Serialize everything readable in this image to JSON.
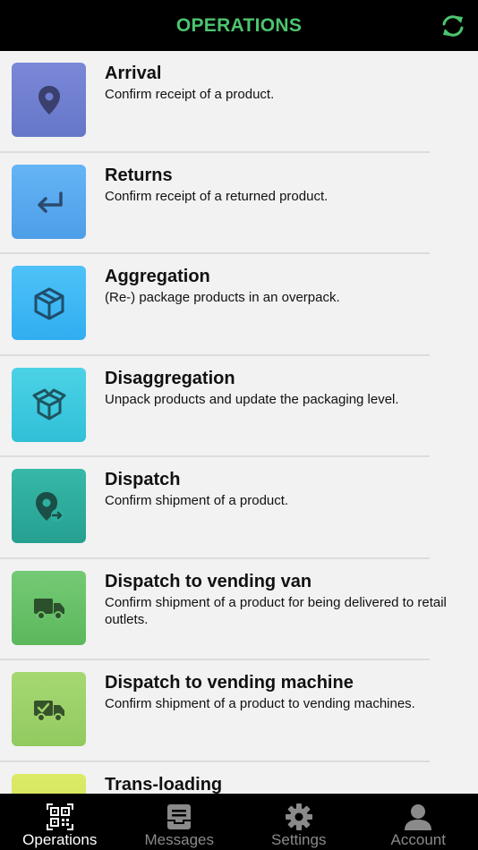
{
  "header": {
    "title": "OPERATIONS",
    "accent": "#4cc46e"
  },
  "operations": [
    {
      "title": "Arrival",
      "description": "Confirm receipt of a product.",
      "icon": "location-pin-icon",
      "color": "#6f7dd0"
    },
    {
      "title": "Returns",
      "description": "Confirm receipt of a returned product.",
      "icon": "return-arrow-icon",
      "color": "#5aa8f0"
    },
    {
      "title": "Aggregation",
      "description": "(Re-) package products in an overpack.",
      "icon": "package-icon",
      "color": "#40b8f4"
    },
    {
      "title": "Disaggregation",
      "description": "Unpack products and update the packaging level.",
      "icon": "open-box-icon",
      "color": "#3fcadf"
    },
    {
      "title": "Dispatch",
      "description": "Confirm shipment of a product.",
      "icon": "location-dispatch-icon",
      "color": "#2fb0a0"
    },
    {
      "title": "Dispatch to vending van",
      "description": "Confirm shipment of a product for being delivered to retail outlets.",
      "icon": "truck-icon",
      "color": "#6cc46c"
    },
    {
      "title": "Dispatch to vending machine",
      "description": "Confirm shipment of a product to vending machines.",
      "icon": "truck-check-icon",
      "color": "#9dd36a"
    },
    {
      "title": "Trans-loading",
      "description": "",
      "icon": "transload-icon",
      "color": "#d8e862"
    }
  ],
  "tabs": [
    {
      "label": "Operations",
      "icon": "qr-code-icon",
      "active": true
    },
    {
      "label": "Messages",
      "icon": "inbox-icon",
      "active": false
    },
    {
      "label": "Settings",
      "icon": "gear-icon",
      "active": false
    },
    {
      "label": "Account",
      "icon": "person-icon",
      "active": false
    }
  ]
}
